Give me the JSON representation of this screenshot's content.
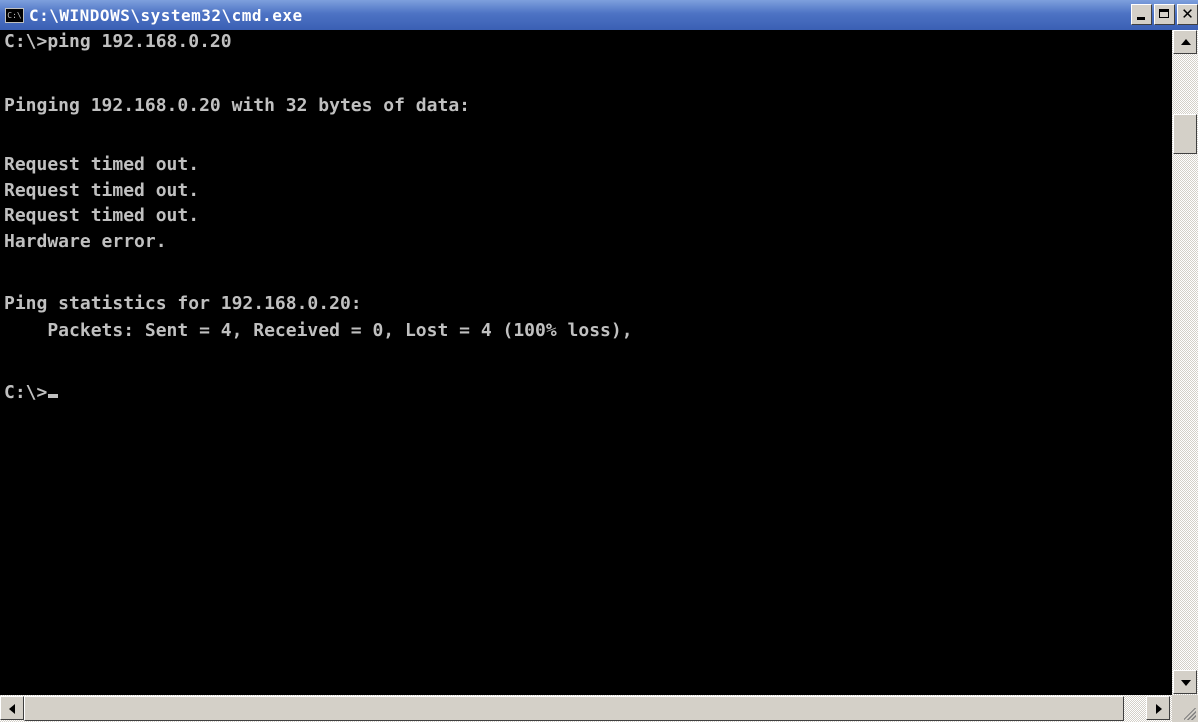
{
  "window": {
    "icon_text": "C:\\",
    "title": "C:\\WINDOWS\\system32\\cmd.exe"
  },
  "console": {
    "lines": [
      "C:\\>ping 192.168.0.20",
      "",
      "Pinging 192.168.0.20 with 32 bytes of data:",
      "",
      "Request timed out.",
      "Request timed out.",
      "Request timed out.",
      "Hardware error.",
      "",
      "Ping statistics for 192.168.0.20:",
      "    Packets: Sent = 4, Received = 0, Lost = 4 (100% loss),",
      "",
      "C:\\>"
    ]
  },
  "colors": {
    "console_bg": "#000000",
    "console_text": "#c0c0c0",
    "titlebar": "#3a5fb4"
  }
}
